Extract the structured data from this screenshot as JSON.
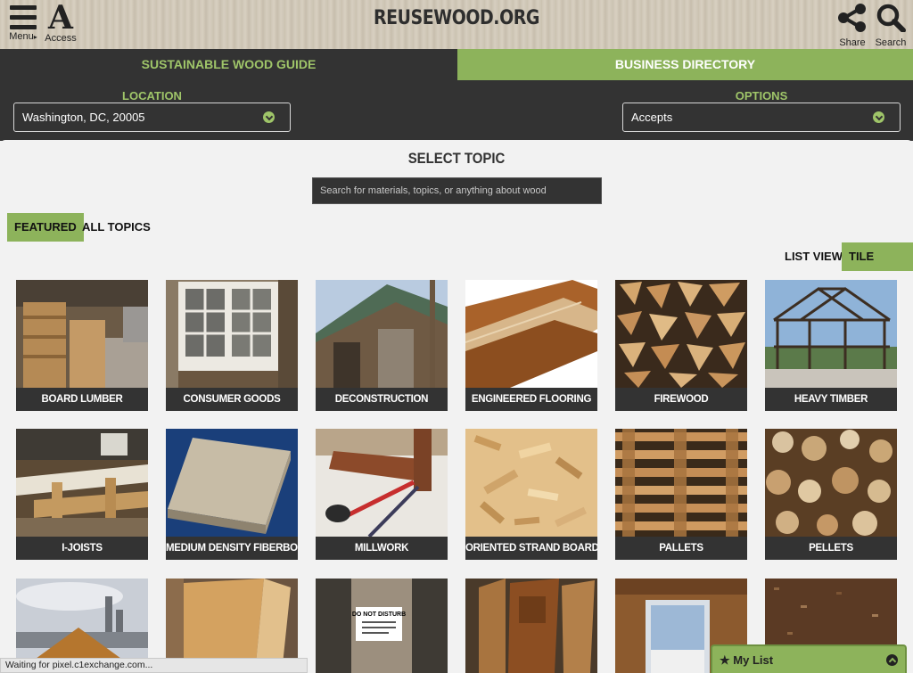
{
  "header": {
    "title": "REUSEWOOD.ORG",
    "menu_label": "Menu",
    "access_label": "Access",
    "access_glyph": "A",
    "share_label": "Share",
    "search_label": "Search"
  },
  "tabs": [
    {
      "label": "SUSTAINABLE WOOD GUIDE",
      "active": false
    },
    {
      "label": "BUSINESS DIRECTORY",
      "active": true
    }
  ],
  "location": {
    "label": "LOCATION",
    "value": "Washington, DC, 20005"
  },
  "options": {
    "label": "OPTIONS",
    "value": "Accepts"
  },
  "main": {
    "title": "SELECT TOPIC",
    "search_placeholder": "Search for materials, topics, or anything about wood",
    "filters": {
      "featured": "FEATURED",
      "all": "ALL TOPICS"
    },
    "views": {
      "list": "LIST VIEW",
      "tile": "TILE VIEW"
    }
  },
  "tiles": [
    {
      "caption": "BOARD LUMBER"
    },
    {
      "caption": "CONSUMER GOODS"
    },
    {
      "caption": "DECONSTRUCTION"
    },
    {
      "caption": "ENGINEERED FLOORING"
    },
    {
      "caption": "FIREWOOD"
    },
    {
      "caption": "HEAVY TIMBER"
    },
    {
      "caption": "I-JOISTS"
    },
    {
      "caption": "MEDIUM DENSITY FIBERBOARD (M"
    },
    {
      "caption": "MILLWORK"
    },
    {
      "caption": "ORIENTED STRAND BOARD (OSB)"
    },
    {
      "caption": "PALLETS"
    },
    {
      "caption": "PELLETS"
    }
  ],
  "sign_text": "DO NOT DISTURB",
  "status_text": "Waiting for pixel.c1exchange.com...",
  "my_list": "My List",
  "colors": {
    "accent": "#8db35b",
    "accent_text": "#9fc569",
    "dark": "#333333"
  }
}
